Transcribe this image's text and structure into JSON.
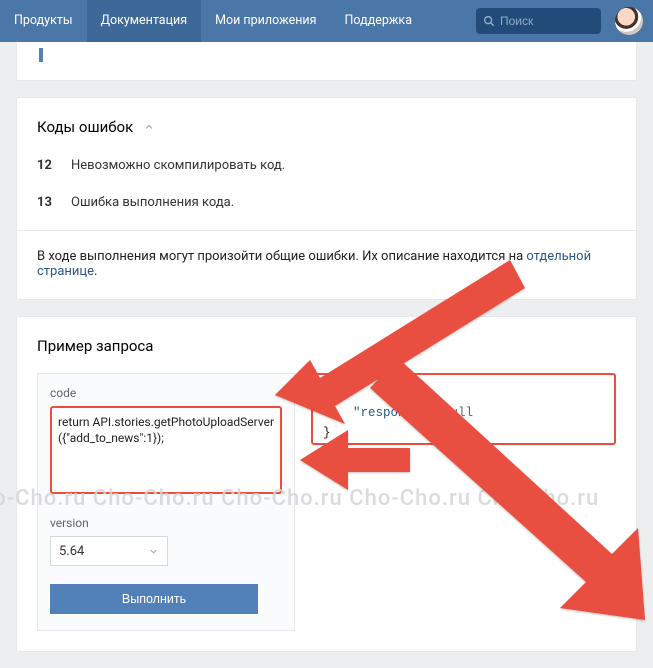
{
  "nav": {
    "items": [
      "Продукты",
      "Документация",
      "Мои приложения",
      "Поддержка"
    ],
    "active_index": 1
  },
  "search": {
    "placeholder": "Поиск"
  },
  "errors_section": {
    "title": "Коды ошибок",
    "rows": [
      {
        "code": "12",
        "msg": "Невозможно скомпилировать код."
      },
      {
        "code": "13",
        "msg": "Ошибка выполнения кода."
      }
    ],
    "general_prefix": "В ходе выполнения могут произойти общие ошибки. Их описание находится на ",
    "general_link": "отдельной странице",
    "general_suffix": "."
  },
  "example": {
    "title": "Пример запроса",
    "code_label": "code",
    "code_value": "return API.stories.getPhotoUploadServer({\"add_to_news\":1});",
    "version_label": "version",
    "version_value": "5.64",
    "run_label": "Выполнить",
    "response_html": "{\n    \"response\": null\n}"
  },
  "watermark": "ho-Cho.ru Cho-Cho.ru Cho-Cho.ru Cho-Cho.ru Cho-Cho.ru"
}
